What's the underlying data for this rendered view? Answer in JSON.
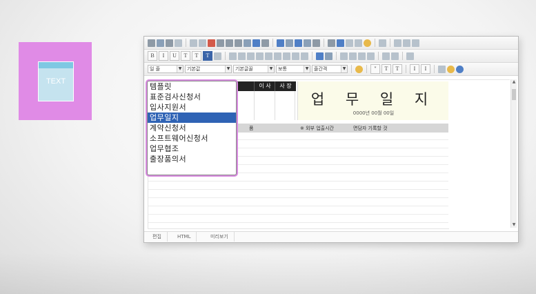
{
  "thumbnail": {
    "label": "TEXT",
    "bg_color": "#e08be6"
  },
  "toolbar": {
    "format_buttons": [
      "B",
      "I",
      "U",
      "T",
      "T",
      "T"
    ],
    "style_select": "일 줄",
    "font_select": "기본값",
    "size_select": "기본글꼴",
    "weight_select": "보통",
    "spacing_select": "줄간격",
    "text_buttons": [
      "\"",
      "T",
      "T",
      "I",
      "I"
    ]
  },
  "document": {
    "approval_headers": [
      "",
      "이 사",
      "사 장"
    ],
    "title": "업 무 일 지",
    "date_line": "0000년 00월 00일",
    "row_labels": [
      "품",
      "※ 외부 업출시간",
      "면담자 기록할 것"
    ]
  },
  "dropdown": {
    "items": [
      "템플릿",
      "표준검사신청서",
      "입사지원서",
      "업무일지",
      "계약신청서",
      "소프트웨어신청서",
      "업무협조",
      "출장품의서"
    ],
    "selected_index": 3
  },
  "tabs": [
    "편집",
    "HTML",
    "미리보기"
  ]
}
